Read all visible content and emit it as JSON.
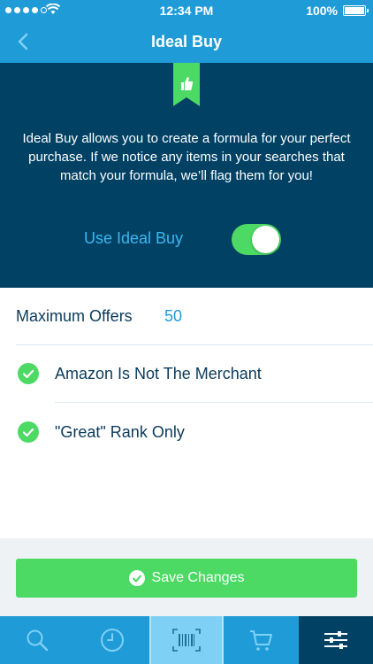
{
  "status_bar": {
    "time": "12:34 PM",
    "battery": "100%",
    "signal_icon": "signal-dots-icon",
    "wifi_icon": "wifi-icon",
    "battery_icon": "battery-icon"
  },
  "nav": {
    "title": "Ideal Buy",
    "back_icon": "chevron-left-icon"
  },
  "hero": {
    "ribbon_icon": "thumbs-up-icon",
    "description": "Ideal Buy allows you to create a formula for your perfect purchase. If we notice any items in your searches that match your formula, we’ll flag them for you!",
    "toggle_label": "Use Ideal Buy",
    "toggle_on": true
  },
  "settings": {
    "max_offers_label": "Maximum Offers",
    "max_offers_value": "50",
    "options": [
      {
        "label": "Amazon Is Not The Merchant",
        "checked": true,
        "icon": "check-circle-icon"
      },
      {
        "label": "\"Great\" Rank Only",
        "checked": true,
        "icon": "check-circle-icon"
      }
    ]
  },
  "save_button": {
    "label": "Save Changes",
    "icon": "check-circle-icon"
  },
  "tab_bar": {
    "tabs": [
      {
        "name": "search",
        "icon": "search-icon"
      },
      {
        "name": "history",
        "icon": "clock-icon"
      },
      {
        "name": "scan",
        "icon": "barcode-icon"
      },
      {
        "name": "cart",
        "icon": "cart-icon"
      },
      {
        "name": "settings",
        "icon": "sliders-icon",
        "active": true
      }
    ]
  },
  "colors": {
    "primary_blue": "#1f9bd7",
    "dark_navy": "#004164",
    "accent_green": "#4cd964",
    "text_dark": "#0a3a5a"
  }
}
